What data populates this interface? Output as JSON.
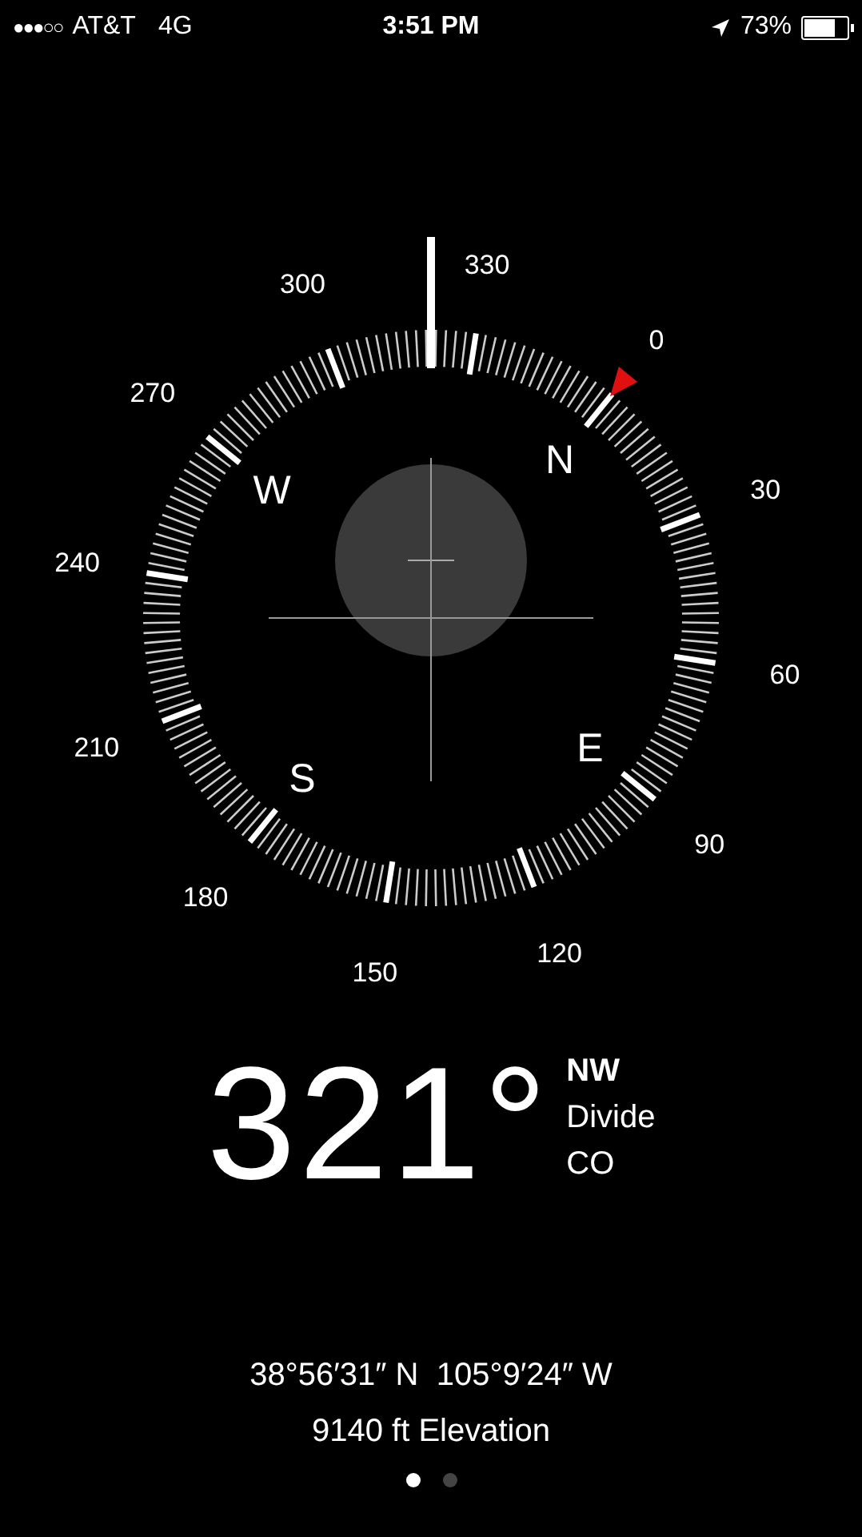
{
  "status_bar": {
    "signal": "●●●○○",
    "carrier": "AT&T",
    "network": "4G",
    "time": "3:51 PM",
    "battery": "73%"
  },
  "compass": {
    "dial_labels": [
      "0",
      "30",
      "60",
      "90",
      "120",
      "150",
      "180",
      "210",
      "240",
      "270",
      "300",
      "330"
    ],
    "cardinals": [
      "N",
      "E",
      "S",
      "W"
    ]
  },
  "reading": {
    "heading": "321°",
    "direction": "NW",
    "place": "Divide",
    "region": "CO"
  },
  "coordinates": "38°56′31″ N  105°9′24″ W",
  "elevation": "9140 ft Elevation",
  "page_dots": [
    {
      "selected": true
    },
    {
      "selected": false
    }
  ]
}
